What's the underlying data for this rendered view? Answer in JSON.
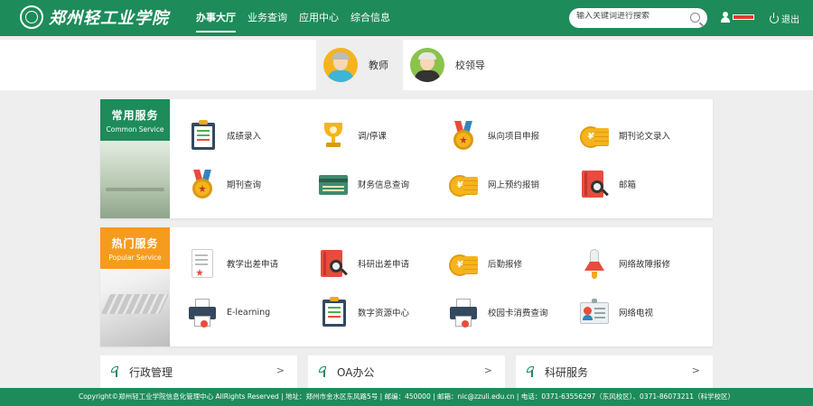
{
  "header": {
    "logo_text": "郑州轻工业学院",
    "nav": [
      "办事大厅",
      "业务查询",
      "应用中心",
      "综合信息"
    ],
    "search_placeholder": "输入关键词进行搜索",
    "logout_label": "退出"
  },
  "roles": [
    {
      "label": "教师",
      "active": true
    },
    {
      "label": "校领导",
      "active": false
    }
  ],
  "common": {
    "title": "常用服务",
    "subtitle": "Common Service",
    "items": [
      {
        "label": "成绩录入",
        "icon": "clipboard-icon"
      },
      {
        "label": "调/停课",
        "icon": "trophy-icon"
      },
      {
        "label": "纵向项目申报",
        "icon": "medal-icon"
      },
      {
        "label": "期刊论文录入",
        "icon": "coins-icon"
      },
      {
        "label": "期刊查询",
        "icon": "medal-icon"
      },
      {
        "label": "财务信息查询",
        "icon": "card-icon"
      },
      {
        "label": "网上预约报销",
        "icon": "coins-icon"
      },
      {
        "label": "邮箱",
        "icon": "book-search-icon"
      }
    ]
  },
  "popular": {
    "title": "热门服务",
    "subtitle": "Popular Service",
    "items": [
      {
        "label": "教学出差申请",
        "icon": "document-icon"
      },
      {
        "label": "科研出差申请",
        "icon": "book-search-icon"
      },
      {
        "label": "后勤报修",
        "icon": "coins-icon"
      },
      {
        "label": "网络故障报修",
        "icon": "rocket-icon"
      },
      {
        "label": "E-learning",
        "icon": "printer-icon"
      },
      {
        "label": "数字资源中心",
        "icon": "clipboard-icon"
      },
      {
        "label": "校园卡消费查询",
        "icon": "printer-icon"
      },
      {
        "label": "网络电视",
        "icon": "id-badge-icon"
      }
    ]
  },
  "cards": [
    {
      "title": "行政管理",
      "arrow": ">"
    },
    {
      "title": "OA办公",
      "arrow": ">"
    },
    {
      "title": "科研服务",
      "arrow": ">"
    }
  ],
  "footer": {
    "text": "Copyright©郑州轻工业学院信息化管理中心   AllRights Reserved  |  地址：郑州市金水区东风路5号  |  邮编：450000  |  邮箱：nic@zzuli.edu.cn  |  电话：0371-63556297（东风校区）、0371-86073211（科学校区）"
  },
  "colors": {
    "brand_green": "#1e8b5a",
    "popular_orange": "#f59c1e"
  }
}
